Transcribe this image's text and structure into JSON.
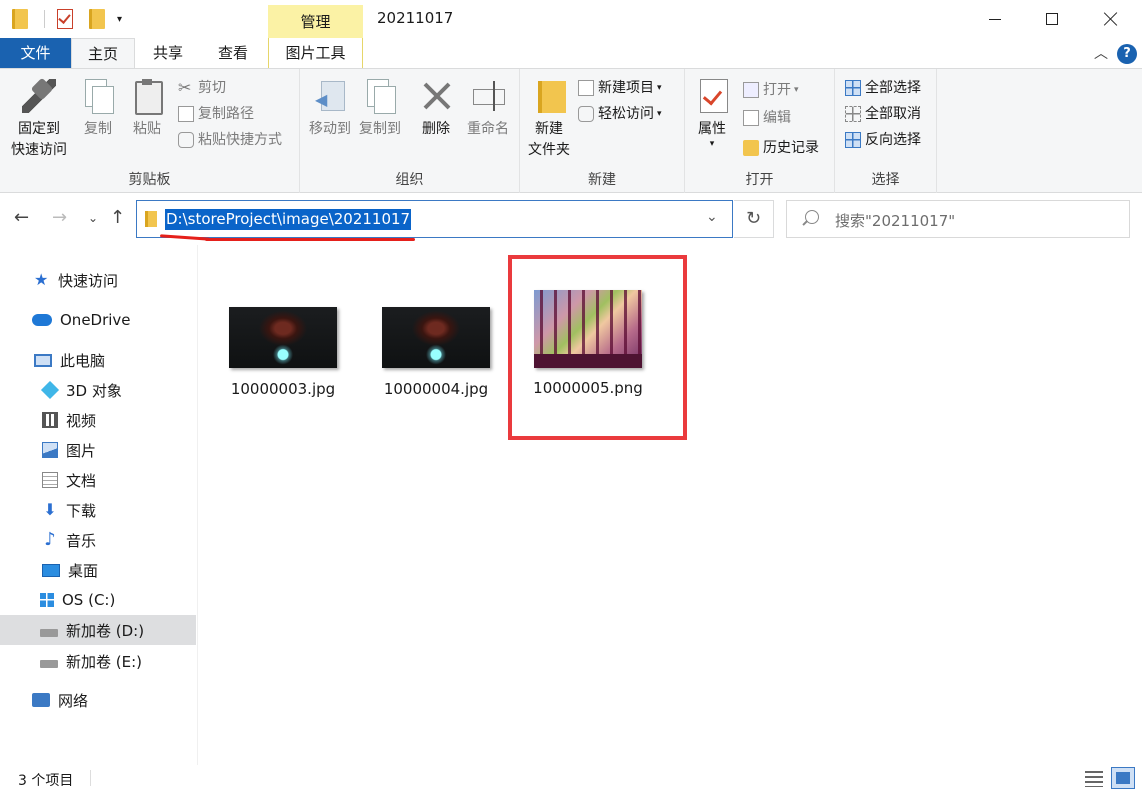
{
  "window": {
    "title": "20211017",
    "manage_tab": "管理",
    "controls": [
      "minimize",
      "maximize",
      "close"
    ]
  },
  "tabs": {
    "file": "文件",
    "home": "主页",
    "share": "共享",
    "view": "查看",
    "picture_tools": "图片工具",
    "help": "?"
  },
  "ribbon": {
    "clipboard": {
      "label": "剪贴板",
      "pin": [
        "固定到",
        "快速访问"
      ],
      "copy": "复制",
      "paste": "粘贴",
      "cut": "剪切",
      "copy_path": "复制路径",
      "paste_shortcut": "粘贴快捷方式"
    },
    "organize": {
      "label": "组织",
      "move_to": "移动到",
      "copy_to": "复制到",
      "delete": "删除",
      "rename": "重命名"
    },
    "new": {
      "label": "新建",
      "new_folder": [
        "新建",
        "文件夹"
      ],
      "new_item": "新建项目",
      "easy_access": "轻松访问"
    },
    "open": {
      "label": "打开",
      "properties": "属性",
      "open": "打开",
      "edit": "编辑",
      "history": "历史记录"
    },
    "select": {
      "label": "选择",
      "select_all": "全部选择",
      "select_none": "全部取消",
      "invert": "反向选择"
    }
  },
  "address": {
    "path": "D:\\storeProject\\image\\20211017",
    "search_placeholder": "搜索\"20211017\""
  },
  "nav": {
    "quick_access": "快速访问",
    "onedrive": "OneDrive",
    "this_pc": "此电脑",
    "objects3d": "3D 对象",
    "videos": "视频",
    "pictures": "图片",
    "documents": "文档",
    "downloads": "下载",
    "music": "音乐",
    "desktop": "桌面",
    "drive_c": "OS (C:)",
    "drive_d": "新加卷 (D:)",
    "drive_e": "新加卷 (E:)",
    "network": "网络"
  },
  "files": [
    {
      "name": "10000003.jpg"
    },
    {
      "name": "10000004.jpg"
    },
    {
      "name": "10000005.png"
    }
  ],
  "status": {
    "count": "3 个项目"
  },
  "colors": {
    "file_tab": "#1a62b0",
    "manage_tab": "#fbf2a5",
    "selection": "#0a64c9",
    "annotation_red": "#ea3a3d"
  }
}
